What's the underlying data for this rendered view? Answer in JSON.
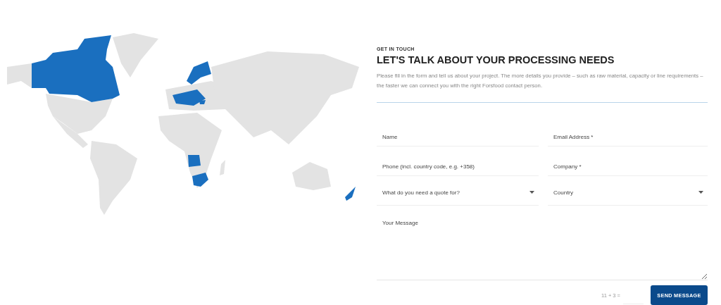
{
  "contact": {
    "eyebrow": "GET IN TOUCH",
    "title": "LET'S TALK ABOUT YOUR PROCESSING NEEDS",
    "intro": "Please fill in the form and tell us about your project. The more details you provide – such as raw material, capacity or line requirements – the faster we can connect you with the right Forsfood contact person."
  },
  "fields": [
    {
      "kind": "input",
      "placeholder": "Name"
    },
    {
      "kind": "input",
      "placeholder": "Email Address *"
    },
    {
      "kind": "input",
      "placeholder": "Phone (incl. country code, e.g. +358)"
    },
    {
      "kind": "input",
      "placeholder": "Company *"
    },
    {
      "kind": "select",
      "placeholder": "What do you need a quote for?"
    },
    {
      "kind": "select",
      "placeholder": "Country"
    }
  ],
  "message": {
    "placeholder": "Your Message"
  },
  "captcha": {
    "question": "11 + 3 ="
  },
  "submit": {
    "label": "SEND MESSAGE"
  }
}
